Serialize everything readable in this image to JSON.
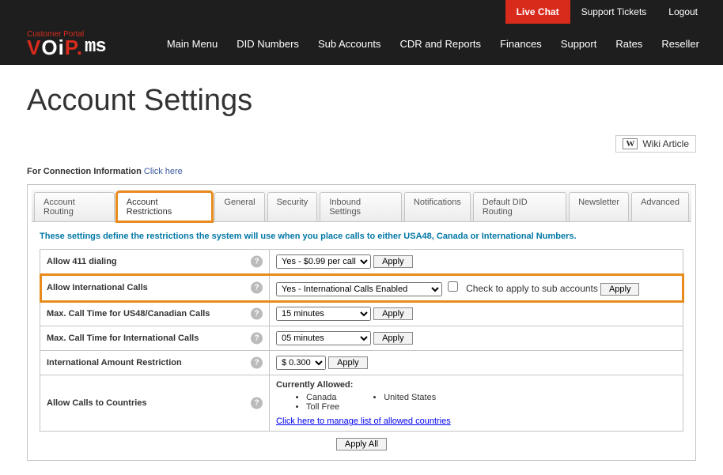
{
  "topbar": {
    "live_chat": "Live Chat",
    "support_tickets": "Support Tickets",
    "logout": "Logout"
  },
  "brand": {
    "tagline": "Customer Portal"
  },
  "nav": {
    "main": "Main Menu",
    "did": "DID Numbers",
    "sub": "Sub Accounts",
    "cdr": "CDR and Reports",
    "fin": "Finances",
    "sup": "Support",
    "rates": "Rates",
    "res": "Reseller"
  },
  "page": {
    "title": "Account Settings",
    "wiki": "Wiki Article",
    "conn_info_lead": "For Connection Information ",
    "conn_info_link": "Click here"
  },
  "tabs": {
    "routing": "Account Routing",
    "restrictions": "Account Restrictions",
    "general": "General",
    "security": "Security",
    "inbound": "Inbound Settings",
    "notifications": "Notifications",
    "diddef": "Default DID Routing",
    "newsletter": "Newsletter",
    "advanced": "Advanced"
  },
  "panel": {
    "intro": "These settings define the restrictions the system will use when you place calls to either USA48, Canada or International Numbers.",
    "rows": {
      "allow411": {
        "label": "Allow 411 dialing",
        "value": "Yes - $0.99 per call",
        "apply": "Apply"
      },
      "intl": {
        "label": "Allow International Calls",
        "value": "Yes - International Calls Enabled",
        "check_label": "Check to apply to sub accounts",
        "apply": "Apply"
      },
      "us48": {
        "label": "Max. Call Time for US48/Canadian Calls",
        "value": "15 minutes",
        "apply": "Apply"
      },
      "intlmax": {
        "label": "Max. Call Time for International Calls",
        "value": "05 minutes",
        "apply": "Apply"
      },
      "amount": {
        "label": "International Amount Restriction",
        "value": "$ 0.300",
        "apply": "Apply"
      },
      "countries": {
        "label": "Allow Calls to Countries",
        "currently": "Currently Allowed:",
        "col1a": "Canada",
        "col1b": "Toll Free",
        "col2a": "United States",
        "manage": "Click here to manage list of allowed countries"
      }
    },
    "apply_all": "Apply All"
  }
}
